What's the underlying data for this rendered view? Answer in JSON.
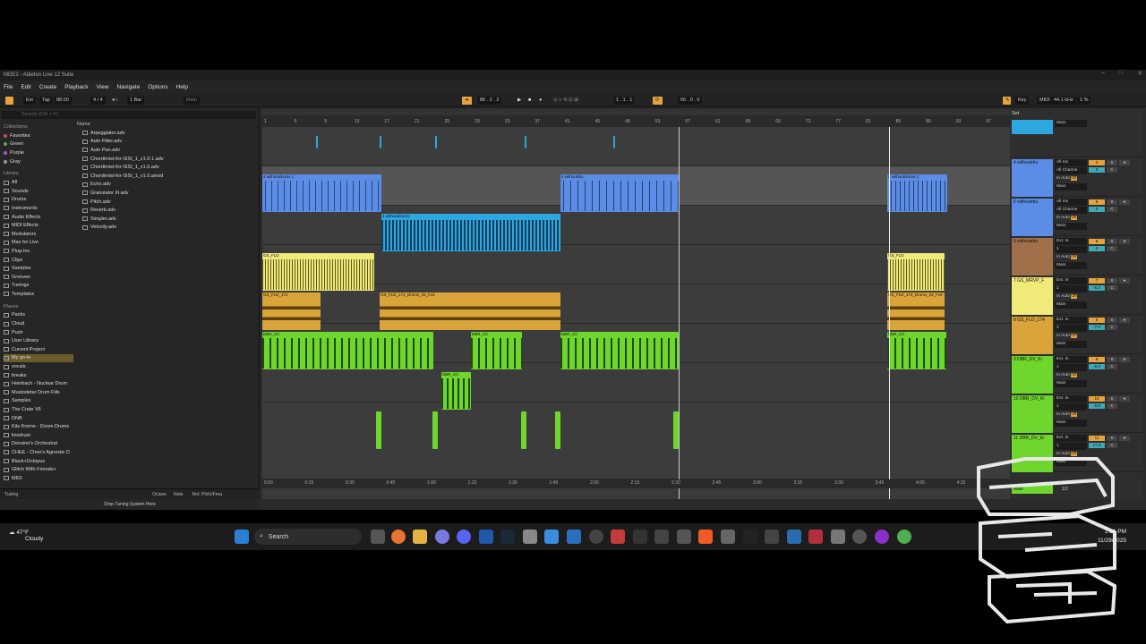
{
  "window": {
    "title": "MDE2 - Ableton Live 12 Suite"
  },
  "menu": [
    "File",
    "Edit",
    "Create",
    "Playback",
    "View",
    "Navigate",
    "Options",
    "Help"
  ],
  "control": {
    "ext": "Ext",
    "tap": "Tap",
    "tempo": "88.00",
    "signature": "4 / 4",
    "quantize": "1 Bar",
    "midi_label": "Main",
    "position": "86 . 2 . 2",
    "loop_start": "1 . 1 . 1",
    "loop_len": "56 . 0 . 0",
    "key": "Key",
    "midi": "MIDI",
    "rate": "44.1 kHz",
    "cpu": "1 %"
  },
  "browser": {
    "search_placeholder": "Search (Ctrl + F)",
    "collections_header": "Collections",
    "collections": [
      {
        "label": "Favorites",
        "color": "#e0435a"
      },
      {
        "label": "Green",
        "color": "#4caf50"
      },
      {
        "label": "Purple",
        "color": "#a05acb"
      },
      {
        "label": "Gray",
        "color": "#9a9a9a"
      }
    ],
    "library_header": "Library",
    "library": [
      "All",
      "Sounds",
      "Drums",
      "Instruments",
      "Audio Effects",
      "MIDI Effects",
      "Modulators",
      "Max for Live",
      "Plug-Ins",
      "Clips",
      "Samples",
      "Grooves",
      "Tunings",
      "Templates"
    ],
    "places_header": "Places",
    "places": [
      "Packs",
      "Cloud",
      "Push",
      "User Library",
      "Current Project",
      "My go-to",
      "vocals",
      "breaks",
      "Heinbach - Nuclear Drum",
      "Mustodetar Drum Fills",
      "Samples",
      "The Crate V6",
      "DNB",
      "Kits Kreme - Doom Drums",
      "linndrum",
      "Densine's Orchestral",
      "CHEE - Chee's Agnostic D",
      "Black+Octopus",
      "Glitch With Friends+",
      "MIDI"
    ],
    "name_header": "Name",
    "files": [
      "Arpeggiator.adv",
      "Auto Filter.adv",
      "Auto Pan.adv",
      "Chordimist-for-SISI_1_v1.0-1.adv",
      "Chordimist-for-SISI_1_v1.0.adv",
      "Chordimist-for-SISI_1_v1.0.amxd",
      "Echo.adv",
      "Granulator III.adv",
      "Pitch.adv",
      "Reverb.adv",
      "Simpler.adv",
      "Velocity.adv"
    ],
    "tuning_label": "Tuning",
    "octave_label": "Octave",
    "note_label": "Note",
    "ref_label": "Ref. Pitch/Freq",
    "drop_hint": "Drop Tuning System Here"
  },
  "ruler": [
    "1",
    "5",
    "9",
    "13",
    "17",
    "21",
    "25",
    "29",
    "33",
    "37",
    "41",
    "45",
    "49",
    "53",
    "57",
    "61",
    "65",
    "69",
    "73",
    "77",
    "81",
    "85",
    "89",
    "93",
    "97"
  ],
  "time_ruler": [
    "0:00",
    "0:15",
    "0:30",
    "0:45",
    "1:00",
    "1:15",
    "1:30",
    "1:45",
    "2:00",
    "2:15",
    "2:30",
    "2:45",
    "3:00",
    "3:15",
    "3:30",
    "3:45",
    "4:00",
    "4:15"
  ],
  "clip_labels": {
    "blue1": "4 withoutdru",
    "blue2": "4 withoutdrums 1",
    "cyan": "4 withoutdrums",
    "yellow": "GS_FLD",
    "orange1": "GS_FLD_174",
    "orange2": "GS_FLD_174_Drums_02_Full",
    "orange3": "GS_FLD_174_Drums_02_Full",
    "green": "DBR_CC",
    "green2": "DBR_CC"
  },
  "mixer": {
    "set_label": "Set",
    "tracks": [
      {
        "name": "",
        "color": "#2ea7e0",
        "input": "Main",
        "num": ""
      },
      {
        "name": "4 withoutdru",
        "color": "#5b8de6",
        "input": "All Ins",
        "chan": "All Channe",
        "out": "Main",
        "num": "4",
        "vol": "0",
        "pan": "C"
      },
      {
        "name": "6 withoutdru",
        "color": "#5b8de6",
        "input": "All Ins",
        "chan": "All Channe",
        "out": "Main",
        "num": "6",
        "vol": "0",
        "pan": "C"
      },
      {
        "name": "6 withoutdru",
        "color": "#a0704a",
        "input": "Ext. In",
        "chan": "1",
        "out": "Main",
        "num": "6",
        "vol": "0",
        "pan": "C"
      },
      {
        "name": "7 GS_MRVP_F",
        "color": "#f0ea7a",
        "input": "Ext. In",
        "chan": "1",
        "out": "Main",
        "num": "7",
        "vol": "-6.4",
        "pan": "C"
      },
      {
        "name": "8 GS_FLD_174",
        "color": "#d9a43a",
        "input": "Ext. In",
        "chan": "1",
        "out": "Main",
        "num": "8",
        "vol": "-7.0",
        "pan": "C"
      },
      {
        "name": "9 DBR_DV_Ki",
        "color": "#6fd62e",
        "input": "Ext. In",
        "chan": "1",
        "out": "Main",
        "num": "9",
        "vol": "-6.8",
        "pan": "C"
      },
      {
        "name": "10 DBR_DV_Ki",
        "color": "#6fd62e",
        "input": "Ext. In",
        "chan": "1",
        "out": "Main",
        "num": "10",
        "vol": "-6.8",
        "pan": "C"
      },
      {
        "name": "11 DBR_DV_Ki",
        "color": "#6fd62e",
        "input": "Ext. In",
        "chan": "1",
        "out": "Main",
        "num": "11",
        "vol": "17.0",
        "pan": "C"
      }
    ],
    "master_out": "Main",
    "master_ratio": "1/2",
    "in_label": "In",
    "auto_label": "Auto",
    "off_label": "Off"
  },
  "taskbar": {
    "temp": "47°F",
    "weather": "Cloudy",
    "search": "Search",
    "time": "1:31 PM",
    "date": "11/29/2025"
  }
}
